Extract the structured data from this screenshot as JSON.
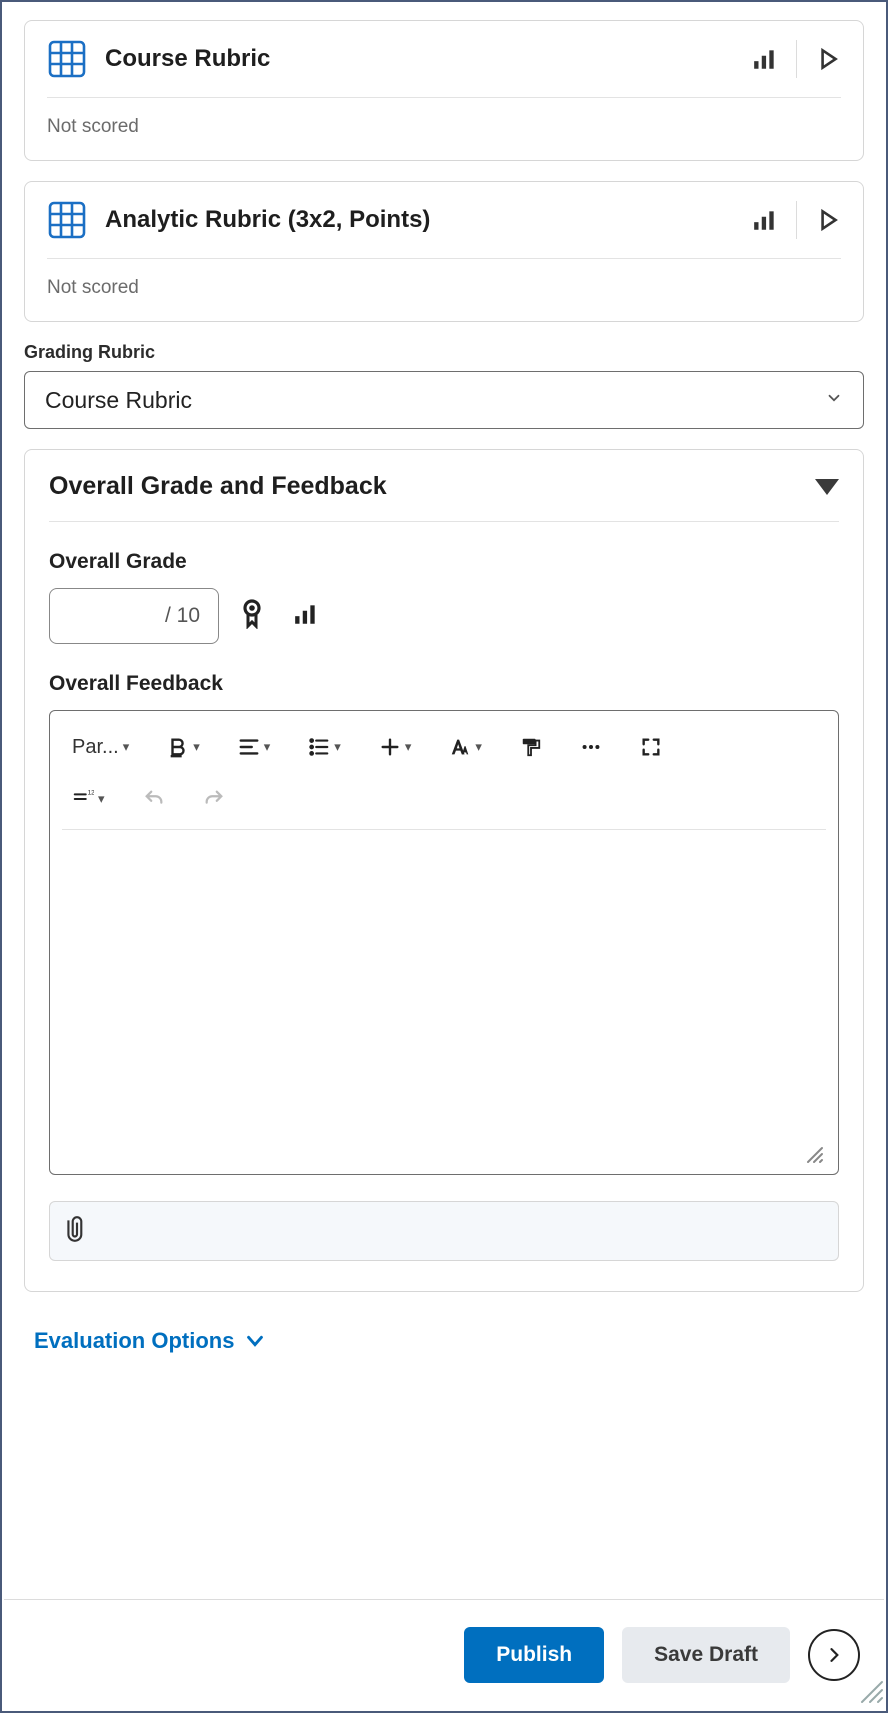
{
  "rubrics": [
    {
      "title": "Course Rubric",
      "status": "Not scored"
    },
    {
      "title": "Analytic Rubric (3x2, Points)",
      "status": "Not scored"
    }
  ],
  "gradingRubric": {
    "label": "Grading Rubric",
    "selected": "Course Rubric"
  },
  "overall": {
    "sectionTitle": "Overall Grade and Feedback",
    "gradeLabel": "Overall Grade",
    "gradeValue": "",
    "gradeDenominator": "/ 10",
    "feedbackLabel": "Overall Feedback",
    "toolbar": {
      "format": "Par..."
    }
  },
  "evalOptions": "Evaluation Options",
  "footer": {
    "publish": "Publish",
    "saveDraft": "Save Draft"
  }
}
